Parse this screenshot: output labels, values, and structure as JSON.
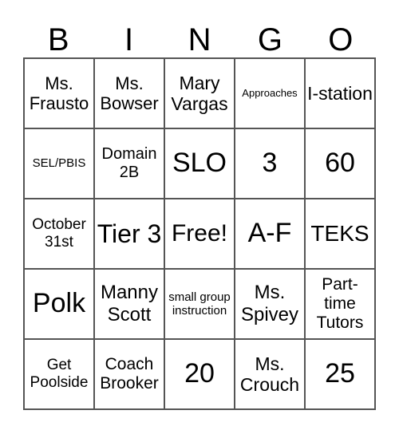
{
  "header": [
    "B",
    "I",
    "N",
    "G",
    "O"
  ],
  "cells": [
    [
      "Ms. Frausto",
      "Ms. Bowser",
      "Mary Vargas",
      "Approaches",
      "I-station"
    ],
    [
      "SEL/PBIS",
      "Domain 2B",
      "SLO",
      "3",
      "60"
    ],
    [
      "October 31st",
      "Tier 3",
      "Free!",
      "A-F",
      "TEKS"
    ],
    [
      "Polk",
      "Manny Scott",
      "small group instruction",
      "Ms. Spivey",
      "Part-time Tutors"
    ],
    [
      "Get Poolside",
      "Coach Brooker",
      "20",
      "Ms. Crouch",
      "25"
    ]
  ]
}
